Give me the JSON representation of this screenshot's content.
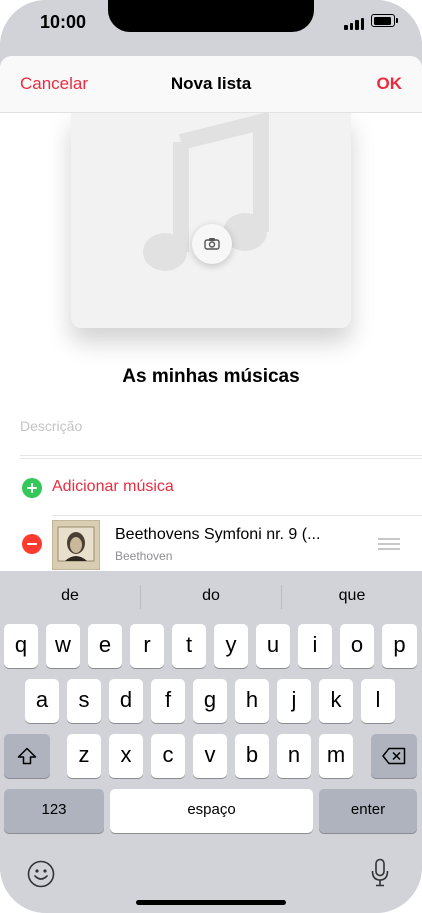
{
  "status": {
    "time": "10:00"
  },
  "navbar": {
    "cancel_label": "Cancelar",
    "title": "Nova lista",
    "ok_label": "OK"
  },
  "playlist": {
    "name": "As minhas músicas",
    "description_placeholder": "Descrição"
  },
  "actions": {
    "add_music_label": "Adicionar música"
  },
  "songs": [
    {
      "title": "Beethovens Symfoni nr. 9 (...",
      "artist": "Beethoven"
    }
  ],
  "keyboard": {
    "suggestions": [
      "de",
      "do",
      "que"
    ],
    "row1": [
      "q",
      "w",
      "e",
      "r",
      "t",
      "y",
      "u",
      "i",
      "o",
      "p"
    ],
    "row2": [
      "a",
      "s",
      "d",
      "f",
      "g",
      "h",
      "j",
      "k",
      "l"
    ],
    "row3": [
      "z",
      "x",
      "c",
      "v",
      "b",
      "n",
      "m"
    ],
    "numbers_label": "123",
    "space_label": "espaço",
    "enter_label": "enter"
  },
  "colors": {
    "accent": "#ea2c3f",
    "add_green": "#34c759",
    "remove_red": "#ff3b30",
    "keyboard_bg": "#d1d3d9"
  },
  "icons": [
    "camera-icon",
    "music-note-icon",
    "plus-icon",
    "minus-icon",
    "reorder-icon",
    "shift-icon",
    "delete-icon",
    "emoji-icon",
    "microphone-icon"
  ]
}
